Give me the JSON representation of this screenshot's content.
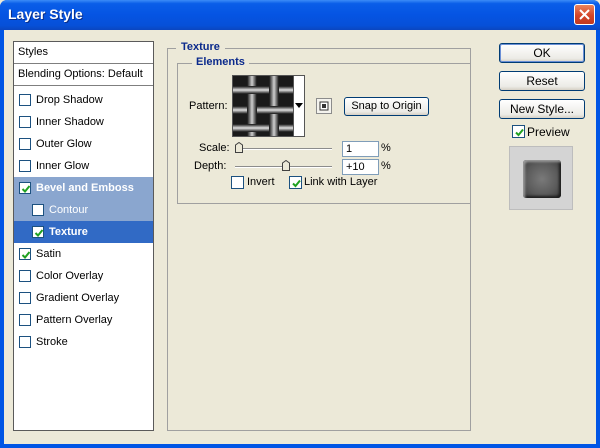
{
  "window": {
    "title": "Layer Style"
  },
  "sidebar": {
    "header": "Styles",
    "blending": "Blending Options: Default",
    "items": [
      {
        "label": "Drop Shadow",
        "checked": false
      },
      {
        "label": "Inner Shadow",
        "checked": false
      },
      {
        "label": "Outer Glow",
        "checked": false
      },
      {
        "label": "Inner Glow",
        "checked": false
      },
      {
        "label": "Bevel and Emboss",
        "checked": true
      },
      {
        "label": "Contour",
        "checked": false
      },
      {
        "label": "Texture",
        "checked": true
      },
      {
        "label": "Satin",
        "checked": true
      },
      {
        "label": "Color Overlay",
        "checked": false
      },
      {
        "label": "Gradient Overlay",
        "checked": false
      },
      {
        "label": "Pattern Overlay",
        "checked": false
      },
      {
        "label": "Stroke",
        "checked": false
      }
    ]
  },
  "texture": {
    "title": "Texture",
    "elements_title": "Elements",
    "pattern_label": "Pattern:",
    "snap_label": "Snap to Origin",
    "scale_label": "Scale:",
    "scale_value": "1",
    "scale_unit": "%",
    "scale_fraction": 0.0,
    "depth_label": "Depth:",
    "depth_value": "+10",
    "depth_unit": "%",
    "depth_fraction": 0.53,
    "invert_label": "Invert",
    "invert_checked": false,
    "link_label": "Link with Layer",
    "link_checked": true
  },
  "buttons": {
    "ok": "OK",
    "reset": "Reset",
    "new_style": "New Style..."
  },
  "preview": {
    "label": "Preview",
    "checked": true
  },
  "colors": {
    "titlebar": "#0554e3",
    "selection": "#316ac5",
    "sub_selection": "#8aa6cf",
    "group_label": "#0b2a8c"
  },
  "icons": [
    "close-icon",
    "checkmark-icon",
    "dropdown-arrow-icon",
    "new-preset-icon",
    "slider-thumb-icon"
  ]
}
